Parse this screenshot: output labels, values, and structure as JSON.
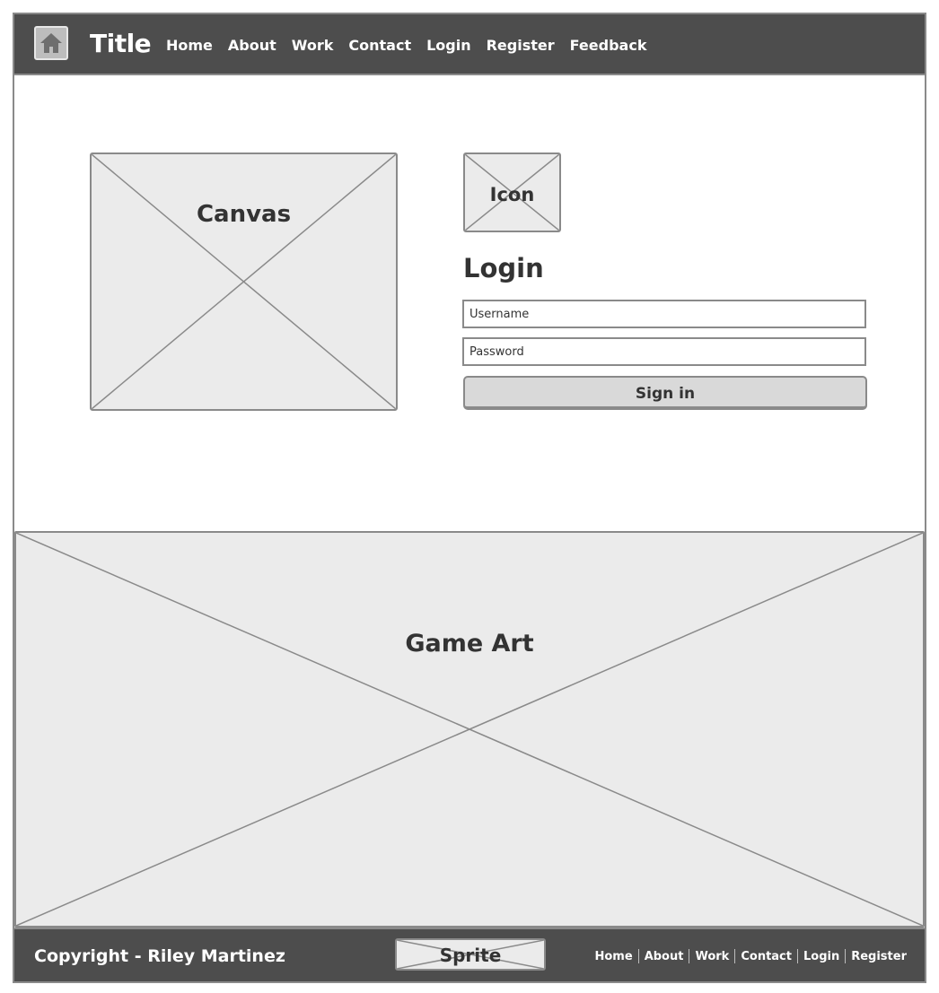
{
  "navbar": {
    "title": "Title",
    "links": [
      "Home",
      "About",
      "Work",
      "Contact",
      "Login",
      "Register",
      "Feedback"
    ]
  },
  "canvas": {
    "label": "Canvas"
  },
  "icon_placeholder": {
    "label": "Icon"
  },
  "login": {
    "title": "Login",
    "username_placeholder": "Username",
    "password_placeholder": "Password",
    "signin_label": "Sign in"
  },
  "game_art": {
    "label": "Game Art"
  },
  "footer": {
    "copyright": "Copyright - Riley Martinez",
    "sprite_label": "Sprite",
    "links": [
      "Home",
      "About",
      "Work",
      "Contact",
      "Login",
      "Register"
    ]
  },
  "colors": {
    "bar_background": "#4d4d4d",
    "placeholder_fill": "#ebebeb",
    "border": "#8a8a8a",
    "text_dark": "#333333"
  }
}
